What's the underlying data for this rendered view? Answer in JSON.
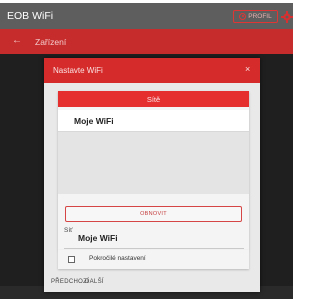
{
  "app": {
    "title": "EOB WiFi",
    "profile_label": "PROFIL"
  },
  "subbar": {
    "back_icon": "arrow-left-icon",
    "title": "Zařízení"
  },
  "dialog": {
    "title": "Nastavte WiFi",
    "close_glyph": "×",
    "networks_header": "Sítě",
    "networks": [
      "Moje WiFi"
    ],
    "refresh_label": "OBNOVIT",
    "ssid_label": "Síť",
    "ssid_value": "Moje WiFi",
    "advanced_label": "Pokročilé nastavení",
    "advanced_checked": false,
    "prev_label": "PŘEDCHOZÍ",
    "next_label": "DALŠÍ"
  },
  "colors": {
    "topbar": "#5e5e5e",
    "accent": "#d52b2b",
    "overlay": "#1f1f1f"
  }
}
